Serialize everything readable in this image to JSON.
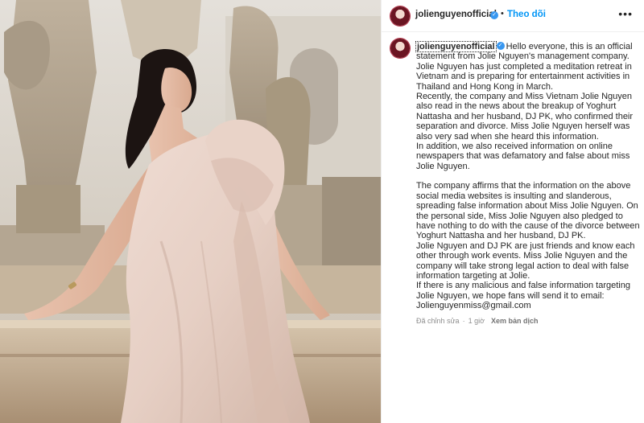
{
  "header": {
    "username": "jolienguyenofficial",
    "separator": "•",
    "follow_label": "Theo dõi",
    "more_label": "•••"
  },
  "post": {
    "username": "jolienguyenofficial",
    "first_line": "Hello everyone, this is an official statement from Jolie Nguyen's management company.",
    "paragraphs": [
      "Jolie Nguyen has just completed a meditation retreat in Vietnam and is preparing for entertainment activities in Thailand and Hong Kong in March.",
      "Recently, the company and Miss Vietnam Jolie Nguyen also read in the news about the breakup of Yoghurt Nattasha and her husband, DJ PK, who confirmed their separation and divorce. Miss Jolie Nguyen herself was also very sad when she heard this information.",
      "In addition, we also received information on online newspapers that was defamatory and false about miss Jolie Nguyen."
    ],
    "paragraphs_2": [
      "The company affirms that the information on the above social media websites is insulting and slanderous, spreading false information about Miss Jolie Nguyen. On the personal side, Miss Jolie Nguyen also pledged to have nothing to do with the cause of the divorce between Yoghurt Nattasha and her husband, DJ PK.",
      "Jolie Nguyen and DJ PK are just friends and know each other through work events. Miss Jolie Nguyen and the company will take strong legal action to deal with false information targeting at Jolie.",
      "If there is any malicious and false information targeting Jolie Nguyen, we hope fans will send it to email:",
      "Jolienguyenmiss@gmail.com"
    ],
    "edited_label": "Đã chỉnh sửa",
    "meta_separator": "·",
    "time_ago": "1 giờ",
    "translate_label": "Xem bản dịch"
  },
  "colors": {
    "accent": "#0095f6",
    "verified": "#3897f0",
    "text": "#262626",
    "muted": "#8e8e8e"
  },
  "icons": {
    "verified": "verified-badge-icon",
    "more": "more-options-icon"
  }
}
